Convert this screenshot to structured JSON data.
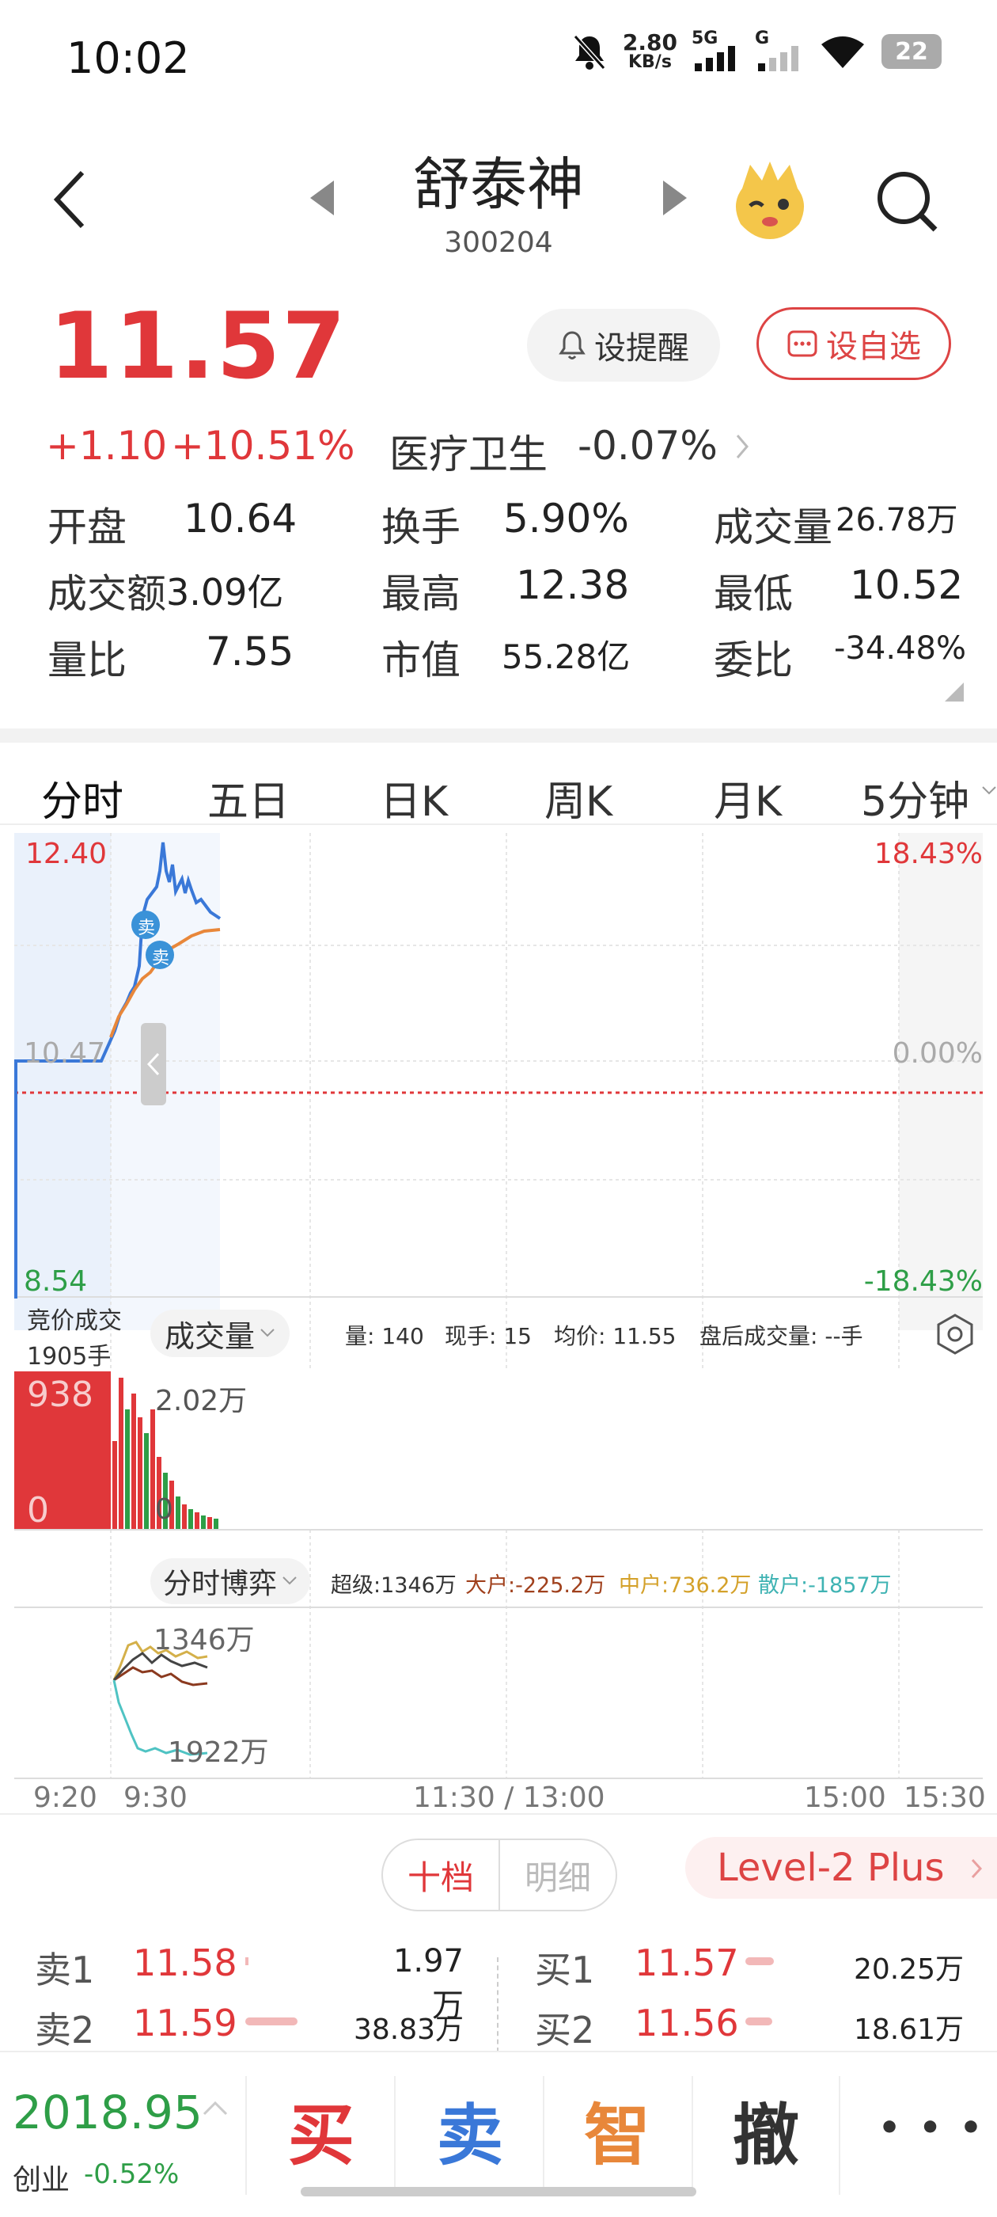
{
  "status_bar": {
    "time": "10:02",
    "net_speed": "2.80",
    "net_unit": "KB/s",
    "signal1": "5G",
    "signal2": "G",
    "battery": "22"
  },
  "header": {
    "stock_name": "舒泰神",
    "stock_code": "300204"
  },
  "quote": {
    "price": "11.57",
    "change": "+1.10",
    "change_pct": "+10.51%",
    "sector_name": "医疗卫生",
    "sector_change": "-0.07%",
    "alert_label": "设提醒",
    "watch_label": "设自选"
  },
  "stats": {
    "open_label": "开盘",
    "open": "10.64",
    "turnover_label": "换手",
    "turnover": "5.90%",
    "volume_label": "成交量",
    "volume": "26.78万",
    "amount_label": "成交额",
    "amount": "3.09亿",
    "high_label": "最高",
    "high": "12.38",
    "low_label": "最低",
    "low": "10.52",
    "ratio_label": "量比",
    "ratio": "7.55",
    "mcap_label": "市值",
    "mcap": "55.28亿",
    "commit_label": "委比",
    "commit": "-34.48%"
  },
  "tabs": [
    "分时",
    "五日",
    "日K",
    "周K",
    "月K",
    "5分钟"
  ],
  "chart": {
    "price_high": "12.40",
    "price_mid": "10.47",
    "price_low": "8.54",
    "pct_high": "18.43%",
    "pct_mid": "0.00%",
    "pct_low": "-18.43%",
    "marker1": "卖",
    "marker2": "卖",
    "auction_label": "竞价成交",
    "auction_vol": "1905手",
    "volume_selector": "成交量",
    "vol_info": "量: 140",
    "cur_hand": "现手: 15",
    "avg_price": "均价: 11.55",
    "after_vol": "盘后成交量: --手",
    "vol_left_top": "938",
    "vol_left_zero": "0",
    "vol_right_top": "2.02万",
    "vol_right_zero": "0",
    "game_selector": "分时博弈",
    "super": "超级:1346万",
    "big": "大户:-225.2万",
    "mid": "中户:736.2万",
    "retail": "散户:-1857万",
    "game_top": "1346万",
    "game_bottom": "1922万",
    "time_labels": [
      "9:20",
      "9:30",
      "11:30 / 13:00",
      "15:00",
      "15:30"
    ]
  },
  "order_book": {
    "tab_active": "十档",
    "tab_inactive": "明细",
    "level2": "Level-2 Plus",
    "sell": [
      {
        "label": "卖1",
        "price": "11.58",
        "vol": "1.97万"
      },
      {
        "label": "卖2",
        "price": "11.59",
        "vol": "38.83万"
      }
    ],
    "buy": [
      {
        "label": "买1",
        "price": "11.57",
        "vol": "20.25万"
      },
      {
        "label": "买2",
        "price": "11.56",
        "vol": "18.61万"
      }
    ]
  },
  "bottom": {
    "index_value": "2018.95",
    "index_name": "创业",
    "index_change": "-0.52%",
    "buy": "买",
    "sell": "卖",
    "smart": "智",
    "cancel": "撤",
    "more": "• • •"
  },
  "colors": {
    "up": "#e0373a",
    "down": "#2e9e47",
    "line_blue": "#3a78d8",
    "avg_orange": "#e8873a"
  }
}
